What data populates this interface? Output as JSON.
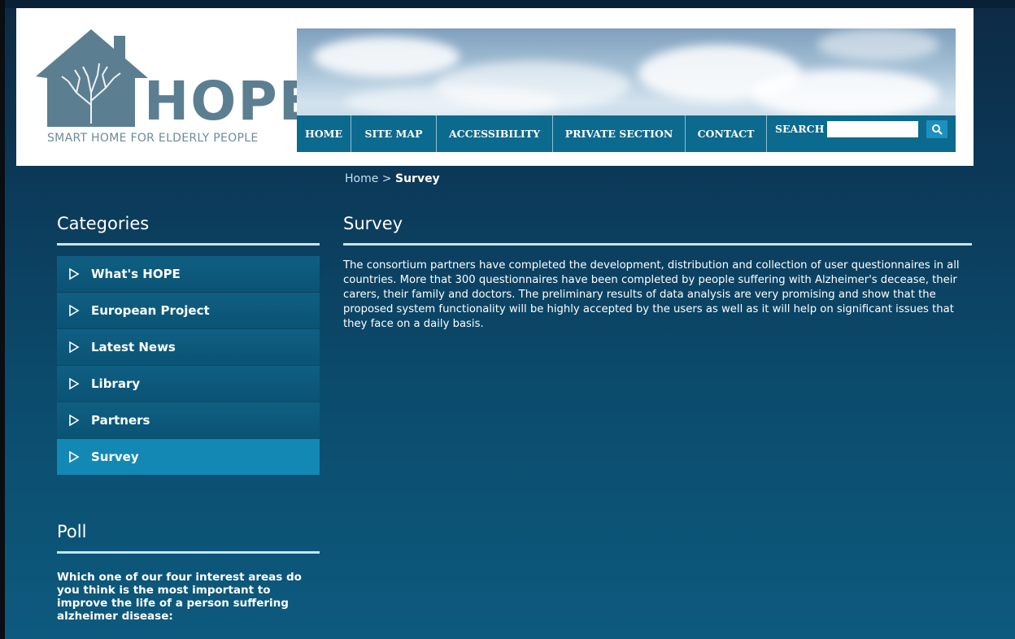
{
  "logo": {
    "wordmark": "HOPE",
    "tagline": "SMART HOME FOR ELDERLY PEOPLE"
  },
  "nav": {
    "items": [
      "HOME",
      "SITE MAP",
      "ACCESSIBILITY",
      "PRIVATE SECTION",
      "CONTACT"
    ],
    "search_label": "SEARCH",
    "search_value": ""
  },
  "breadcrumb": {
    "home": "Home",
    "separator": ">",
    "current": "Survey"
  },
  "sidebar": {
    "categories_heading": "Categories",
    "categories": [
      "What's HOPE",
      "European Project",
      "Latest News",
      "Library",
      "Partners",
      "Survey"
    ],
    "active_category": "Survey",
    "poll_heading": "Poll",
    "poll_question": "Which one of our four interest areas do you think is the most important to improve the life of a person suffering alzheimer disease:"
  },
  "main": {
    "title": "Survey",
    "body": "The consortium partners have completed the development, distribution and collection of user questionnaires in all countries. More that 300 questionnaires have been completed by people suffering with Alzheimer's decease, their carers, their family and doctors. The preliminary results of data analysis are very promising and show that the proposed system functionality will be highly accepted by the users as well as it will help on significant issues that they face on a daily basis."
  },
  "colors": {
    "nav": "#0c6a8e",
    "active": "#1488b4",
    "logo": "#5b7f91"
  }
}
